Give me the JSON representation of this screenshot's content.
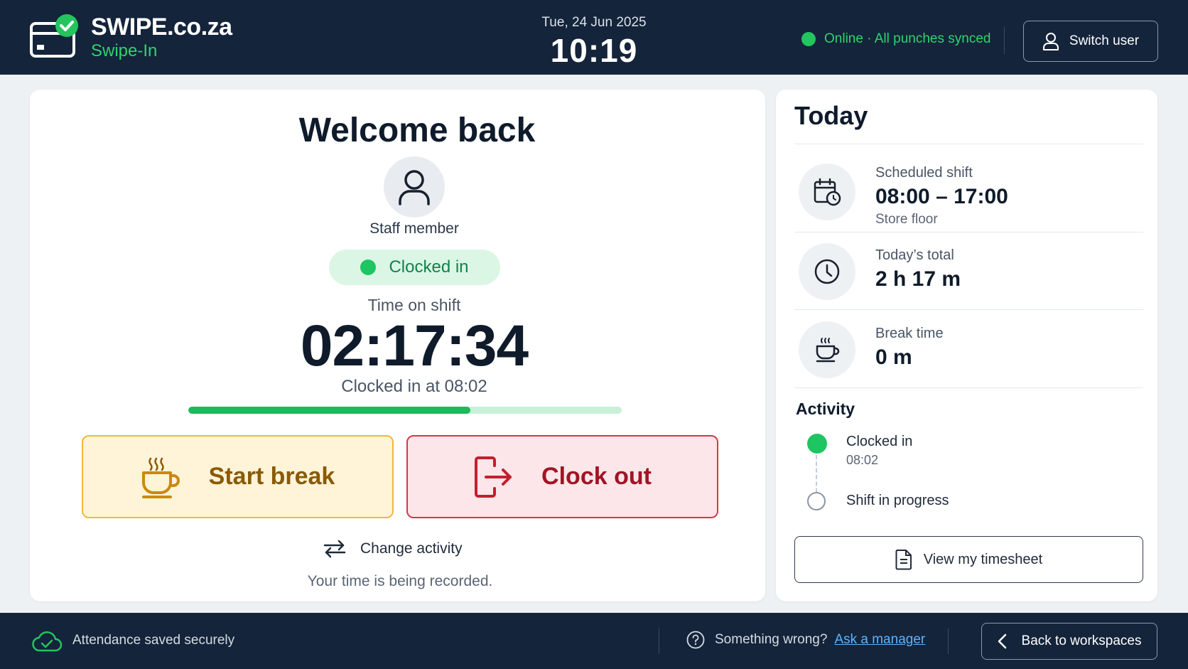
{
  "header": {
    "brand_name": "SWIPE.co.za",
    "brand_sub": "Swipe-In",
    "date": "Tue, 24 Jun 2025",
    "time": "10:19",
    "sync_status": "Online · All punches synced",
    "switch_user_label": "Switch user"
  },
  "main": {
    "welcome": "Welcome back",
    "staff_label": "Staff member",
    "status": "Clocked in",
    "time_on_shift_label": "Time on shift",
    "timer": "02:17:34",
    "clocked_in_at": "Clocked in at 08:02",
    "shift_progress_percent": 65,
    "start_break_label": "Start break",
    "clock_out_label": "Clock out",
    "change_activity_label": "Change activity",
    "recording_note": "Your time is being recorded."
  },
  "today": {
    "title": "Today",
    "scheduled": {
      "label": "Scheduled shift",
      "value": "08:00 – 17:00",
      "sub": "Store floor"
    },
    "total": {
      "label": "Today’s total",
      "value": "2 h 17 m"
    },
    "break": {
      "label": "Break time",
      "value": "0 m"
    },
    "activity_title": "Activity",
    "activity": [
      {
        "label": "Clocked in",
        "time": "08:02"
      },
      {
        "label": "Shift in progress"
      }
    ],
    "timesheet_label": "View my timesheet"
  },
  "footer": {
    "saved": "Attendance saved securely",
    "help_text": "Something wrong?",
    "help_link": "Ask a manager",
    "back_label": "Back to workspaces"
  },
  "colors": {
    "header_bg": "#14243a",
    "accent_green": "#22c55e",
    "break_bg": "#fff4d8",
    "break_border": "#f0b93a",
    "clock_out_bg": "#fde6ea",
    "clock_out_border": "#d13a4a",
    "link": "#5cb4ff"
  },
  "icons": {
    "brand": "card-check-icon",
    "switch_user": "user-icon",
    "avatar": "user-icon",
    "start_break": "coffee-cup-icon",
    "clock_out": "logout-icon",
    "change_activity": "swap-arrows-icon",
    "scheduled": "calendar-clock-icon",
    "total": "clock-icon",
    "break": "coffee-cup-icon",
    "timesheet": "document-icon",
    "saved": "cloud-check-icon",
    "help": "question-circle-icon",
    "back": "chevron-left-icon"
  }
}
